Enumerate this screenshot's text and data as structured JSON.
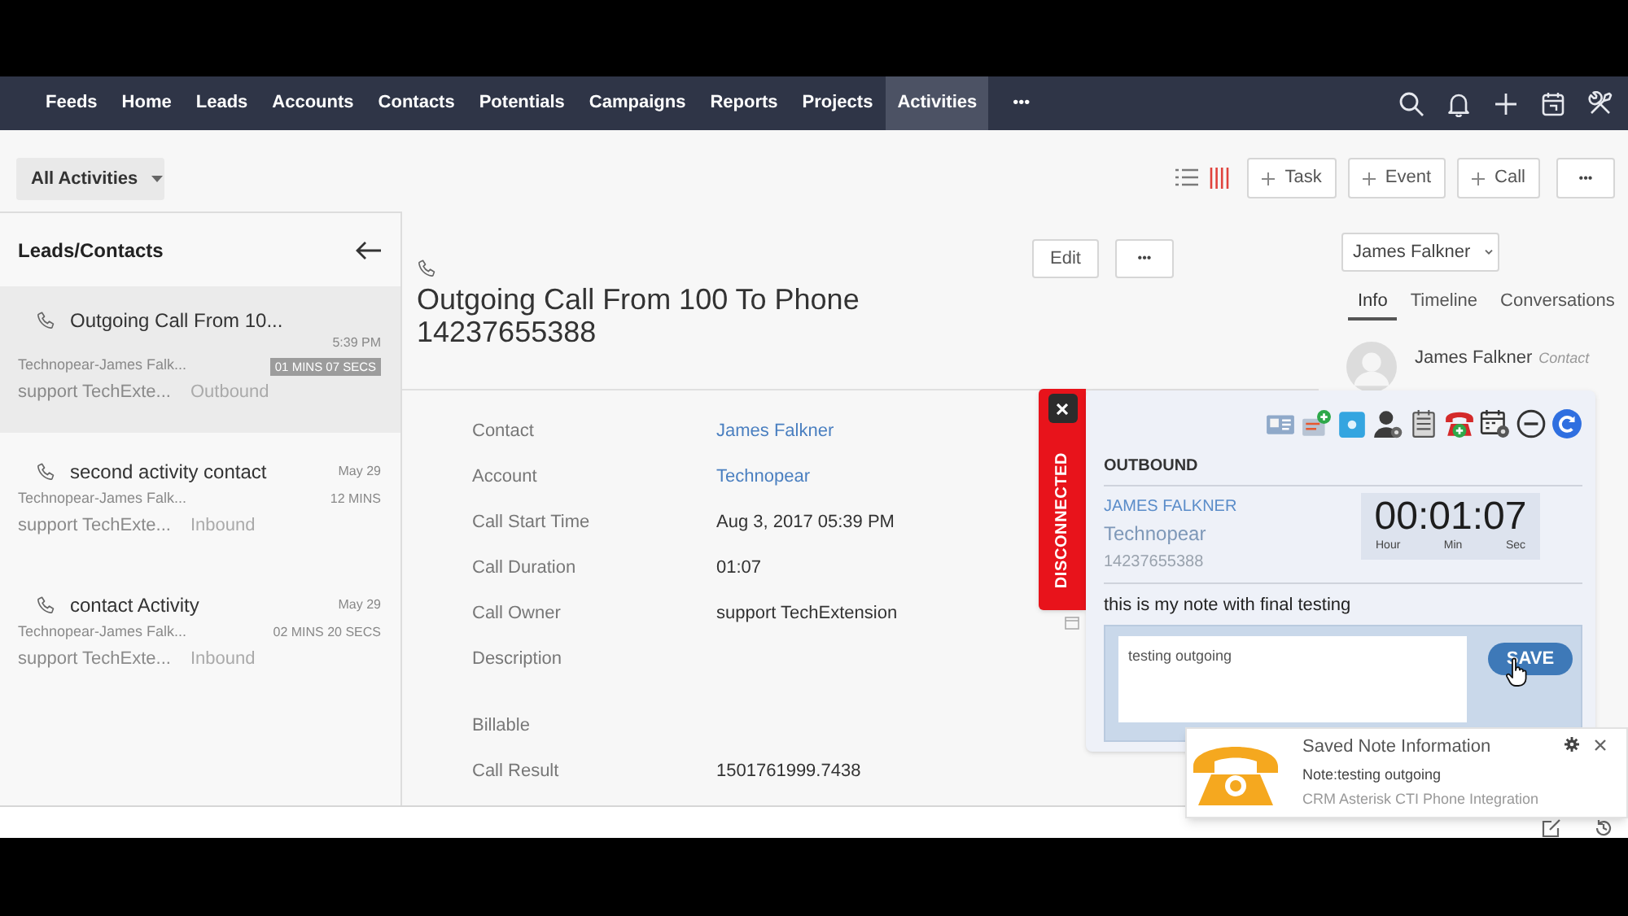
{
  "nav": {
    "items": [
      {
        "label": "Feeds",
        "selected": false
      },
      {
        "label": "Home",
        "selected": false
      },
      {
        "label": "Leads",
        "selected": false
      },
      {
        "label": "Accounts",
        "selected": false
      },
      {
        "label": "Contacts",
        "selected": false
      },
      {
        "label": "Potentials",
        "selected": false
      },
      {
        "label": "Campaigns",
        "selected": false
      },
      {
        "label": "Reports",
        "selected": false
      },
      {
        "label": "Projects",
        "selected": false
      },
      {
        "label": "Activities",
        "selected": true
      }
    ],
    "more": "•••"
  },
  "toolbar": {
    "view_filter": "All Activities",
    "view_modes": [
      {
        "kind": "list",
        "selected": false
      },
      {
        "kind": "columns",
        "selected": true
      }
    ],
    "buttons": [
      "Task",
      "Event",
      "Call"
    ],
    "more": "•••"
  },
  "sidebar": {
    "title": "Leads/Contacts",
    "items": [
      {
        "title": "Outgoing Call From 10...",
        "time": "5:39 PM",
        "account": "Technopear-James Falk...",
        "duration": "01 MINS 07 SECS",
        "owner": "support TechExte...",
        "direction": "Outbound",
        "selected": true
      },
      {
        "title": "second activity contact",
        "time": "May 29",
        "account": "Technopear-James Falk...",
        "duration": "12 MINS",
        "owner": "support TechExte...",
        "direction": "Inbound",
        "selected": false
      },
      {
        "title": "contact Activity",
        "time": "May 29",
        "account": "Technopear-James Falk...",
        "duration": "02 MINS 20 SECS",
        "owner": "support TechExte...",
        "direction": "Inbound",
        "selected": false
      }
    ]
  },
  "detail": {
    "title": "Outgoing Call From 100 To Phone 14237655388",
    "buttons": [
      "Edit"
    ],
    "more": "•••",
    "fields": [
      {
        "label": "Contact",
        "value": "James Falkner",
        "kind": "link"
      },
      {
        "label": "Account",
        "value": "Technopear",
        "kind": "link"
      },
      {
        "label": "Call Start Time",
        "value": "Aug 3, 2017 05:39 PM",
        "kind": "text"
      },
      {
        "label": "Call Duration",
        "value": "01:07",
        "kind": "text"
      },
      {
        "label": "Call Owner",
        "value": "support TechExtension",
        "kind": "text"
      },
      {
        "label": "Description",
        "kind": "multiline"
      },
      {
        "label": "Billable",
        "kind": "text"
      },
      {
        "label": "Call Result",
        "value": "1501761999.7438",
        "kind": "text"
      }
    ]
  },
  "contact_panel": {
    "selector": "James Falkner",
    "tabs": [
      {
        "label": "Info",
        "selected": true
      },
      {
        "label": "Timeline",
        "selected": false
      },
      {
        "label": "Conversations",
        "selected": false
      }
    ],
    "name": "James Falkner",
    "role": "Contact"
  },
  "call_popup": {
    "status": "DISCONNECTED",
    "direction": "OUTBOUND",
    "contact_name": "JAMES FALKNER",
    "account": "Technopear",
    "phone": "14237655388",
    "timer": {
      "value": "00:01:07",
      "units": [
        "Hour",
        "Min",
        "Sec"
      ]
    },
    "note": "this is my note with final testing",
    "note_input": {
      "value": "testing outgoing"
    },
    "save_button": "SAVE"
  },
  "notification": {
    "title": "Saved Note Information",
    "message": "Note:testing outgoing",
    "source": "CRM Asterisk CTI Phone Integration"
  }
}
